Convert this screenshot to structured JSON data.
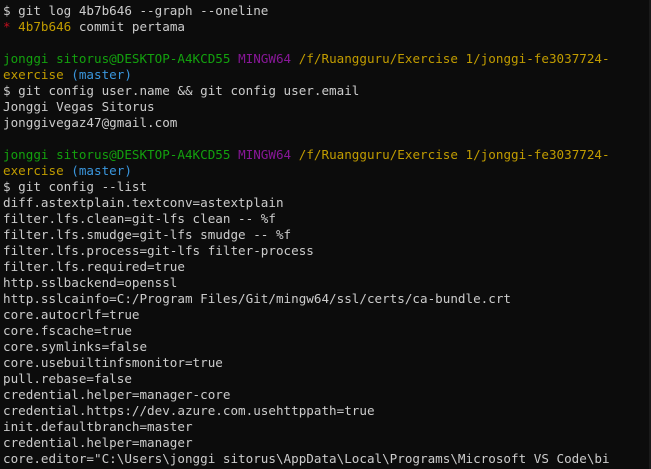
{
  "terminal": {
    "colors": {
      "background": "#0c0c0c",
      "default": "#cccccc",
      "yellow": "#c19c00",
      "green": "#13a10e",
      "magenta": "#881798",
      "cyan": "#3a96dd",
      "red": "#c50f1f"
    },
    "lines": [
      {
        "name": "command-line",
        "segments": [
          {
            "t": "$ git log 4b7b646 --graph --oneline",
            "c": "white"
          }
        ]
      },
      {
        "name": "log-entry",
        "segments": [
          {
            "t": "* ",
            "c": "red"
          },
          {
            "t": "4b7b646",
            "c": "yellow"
          },
          {
            "t": " commit pertama",
            "c": "white"
          }
        ]
      },
      {
        "name": "blank-line",
        "segments": [
          {
            "t": " ",
            "c": "white"
          }
        ]
      },
      {
        "name": "prompt-line",
        "segments": [
          {
            "t": "jonggi sitorus@DESKTOP-A4KCD55",
            "c": "green"
          },
          {
            "t": " ",
            "c": "white"
          },
          {
            "t": "MINGW64",
            "c": "magenta"
          },
          {
            "t": " ",
            "c": "white"
          },
          {
            "t": "/f/Ruangguru/Exercise 1/jonggi-fe3037724-",
            "c": "yellow"
          }
        ]
      },
      {
        "name": "prompt-line-cont",
        "segments": [
          {
            "t": "exercise",
            "c": "yellow"
          },
          {
            "t": " ",
            "c": "white"
          },
          {
            "t": "(master)",
            "c": "cyan"
          }
        ]
      },
      {
        "name": "command-line",
        "segments": [
          {
            "t": "$ git config user.name && git config user.email",
            "c": "white"
          }
        ]
      },
      {
        "name": "output-line",
        "segments": [
          {
            "t": "Jonggi Vegas Sitorus",
            "c": "white"
          }
        ]
      },
      {
        "name": "output-line",
        "segments": [
          {
            "t": "jonggivegaz47@gmail.com",
            "c": "white"
          }
        ]
      },
      {
        "name": "blank-line",
        "segments": [
          {
            "t": " ",
            "c": "white"
          }
        ]
      },
      {
        "name": "prompt-line",
        "segments": [
          {
            "t": "jonggi sitorus@DESKTOP-A4KCD55",
            "c": "green"
          },
          {
            "t": " ",
            "c": "white"
          },
          {
            "t": "MINGW64",
            "c": "magenta"
          },
          {
            "t": " ",
            "c": "white"
          },
          {
            "t": "/f/Ruangguru/Exercise 1/jonggi-fe3037724-",
            "c": "yellow"
          }
        ]
      },
      {
        "name": "prompt-line-cont",
        "segments": [
          {
            "t": "exercise",
            "c": "yellow"
          },
          {
            "t": " ",
            "c": "white"
          },
          {
            "t": "(master)",
            "c": "cyan"
          }
        ]
      },
      {
        "name": "command-line",
        "segments": [
          {
            "t": "$ git config --list",
            "c": "white"
          }
        ]
      },
      {
        "name": "output-line",
        "segments": [
          {
            "t": "diff.astextplain.textconv=astextplain",
            "c": "white"
          }
        ]
      },
      {
        "name": "output-line",
        "segments": [
          {
            "t": "filter.lfs.clean=git-lfs clean -- %f",
            "c": "white"
          }
        ]
      },
      {
        "name": "output-line",
        "segments": [
          {
            "t": "filter.lfs.smudge=git-lfs smudge -- %f",
            "c": "white"
          }
        ]
      },
      {
        "name": "output-line",
        "segments": [
          {
            "t": "filter.lfs.process=git-lfs filter-process",
            "c": "white"
          }
        ]
      },
      {
        "name": "output-line",
        "segments": [
          {
            "t": "filter.lfs.required=true",
            "c": "white"
          }
        ]
      },
      {
        "name": "output-line",
        "segments": [
          {
            "t": "http.sslbackend=openssl",
            "c": "white"
          }
        ]
      },
      {
        "name": "output-line",
        "segments": [
          {
            "t": "http.sslcainfo=C:/Program Files/Git/mingw64/ssl/certs/ca-bundle.crt",
            "c": "white"
          }
        ]
      },
      {
        "name": "output-line",
        "segments": [
          {
            "t": "core.autocrlf=true",
            "c": "white"
          }
        ]
      },
      {
        "name": "output-line",
        "segments": [
          {
            "t": "core.fscache=true",
            "c": "white"
          }
        ]
      },
      {
        "name": "output-line",
        "segments": [
          {
            "t": "core.symlinks=false",
            "c": "white"
          }
        ]
      },
      {
        "name": "output-line",
        "segments": [
          {
            "t": "core.usebuiltinfsmonitor=true",
            "c": "white"
          }
        ]
      },
      {
        "name": "output-line",
        "segments": [
          {
            "t": "pull.rebase=false",
            "c": "white"
          }
        ]
      },
      {
        "name": "output-line",
        "segments": [
          {
            "t": "credential.helper=manager-core",
            "c": "white"
          }
        ]
      },
      {
        "name": "output-line",
        "segments": [
          {
            "t": "credential.https://dev.azure.com.usehttppath=true",
            "c": "white"
          }
        ]
      },
      {
        "name": "output-line",
        "segments": [
          {
            "t": "init.defaultbranch=master",
            "c": "white"
          }
        ]
      },
      {
        "name": "output-line",
        "segments": [
          {
            "t": "credential.helper=manager",
            "c": "white"
          }
        ]
      },
      {
        "name": "output-line",
        "segments": [
          {
            "t": "core.editor=\"C:\\Users\\jonggi sitorus\\AppData\\Local\\Programs\\Microsoft VS Code\\bi",
            "c": "white"
          }
        ]
      }
    ]
  }
}
